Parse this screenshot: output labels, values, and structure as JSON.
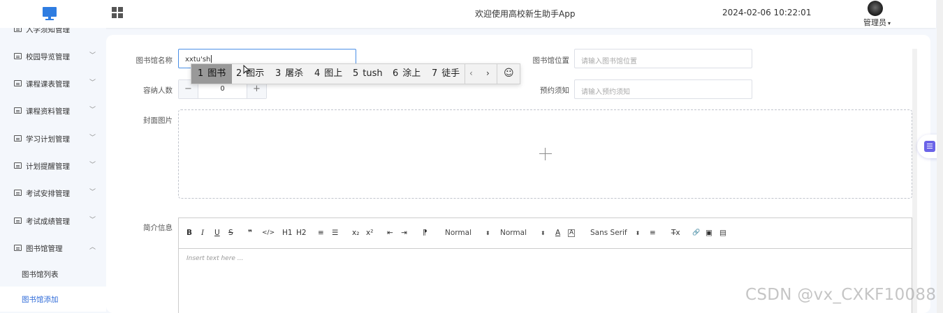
{
  "header": {
    "app_title": "欢迎使用高校新生助手App",
    "datetime": "2024-02-06 10:22:01",
    "user_name": "管理员",
    "user_caret": "▾"
  },
  "sidebar": {
    "items": [
      {
        "label": "入学须知管理",
        "arrow": "﹀"
      },
      {
        "label": "校园导览管理",
        "arrow": "﹀"
      },
      {
        "label": "课程课表管理",
        "arrow": "﹀"
      },
      {
        "label": "课程资料管理",
        "arrow": "﹀"
      },
      {
        "label": "学习计划管理",
        "arrow": "﹀"
      },
      {
        "label": "计划提醒管理",
        "arrow": "﹀"
      },
      {
        "label": "考试安排管理",
        "arrow": "﹀"
      },
      {
        "label": "考试成绩管理",
        "arrow": "﹀"
      },
      {
        "label": "图书馆管理",
        "arrow": "︿"
      }
    ],
    "sub_items": [
      {
        "label": "图书馆列表"
      },
      {
        "label": "图书馆添加"
      }
    ]
  },
  "form": {
    "name_label": "图书馆名称",
    "name_value": "xxtu'sh",
    "location_label": "图书馆位置",
    "location_placeholder": "请输入图书馆位置",
    "capacity_label": "容纳人数",
    "capacity_value": "0",
    "capacity_minus": "−",
    "capacity_plus": "+",
    "notice_label": "预约须知",
    "notice_placeholder": "请输入预约须知",
    "cover_label": "封面图片",
    "intro_label": "简介信息"
  },
  "editor": {
    "toolbar": {
      "bold": "B",
      "italic": "I",
      "underline": "U",
      "strike": "S",
      "quote": "❞",
      "code": "</>",
      "h1": "H1",
      "h2": "H2",
      "ordered": "≡",
      "bullet": "☰",
      "sub": "x₂",
      "sup": "x²",
      "outdent": "⇤",
      "indent": "⇥",
      "direction": "⁋",
      "size_select": "Normal",
      "header_select": "Normal",
      "color": "A",
      "background": "A",
      "font_select": "Sans Serif",
      "align": "≡",
      "clean": "T̶x",
      "link": "🔗",
      "image": "▣",
      "video": "▤"
    },
    "placeholder": "Insert text here ..."
  },
  "ime": {
    "candidates": [
      {
        "num": "1",
        "text": "图书"
      },
      {
        "num": "2",
        "text": "图示"
      },
      {
        "num": "3",
        "text": "屠杀"
      },
      {
        "num": "4",
        "text": "图上"
      },
      {
        "num": "5",
        "text": "tush"
      },
      {
        "num": "6",
        "text": "涂上"
      },
      {
        "num": "7",
        "text": "徒手"
      }
    ],
    "prev": "‹",
    "next": "›",
    "emoji": "☺"
  },
  "watermark": "CSDN @vx_CXKF10088",
  "colors": {
    "accent": "#2f6bd8",
    "focus_border": "#4a8fe6",
    "sidebar_bg": "#f4f7fc"
  }
}
